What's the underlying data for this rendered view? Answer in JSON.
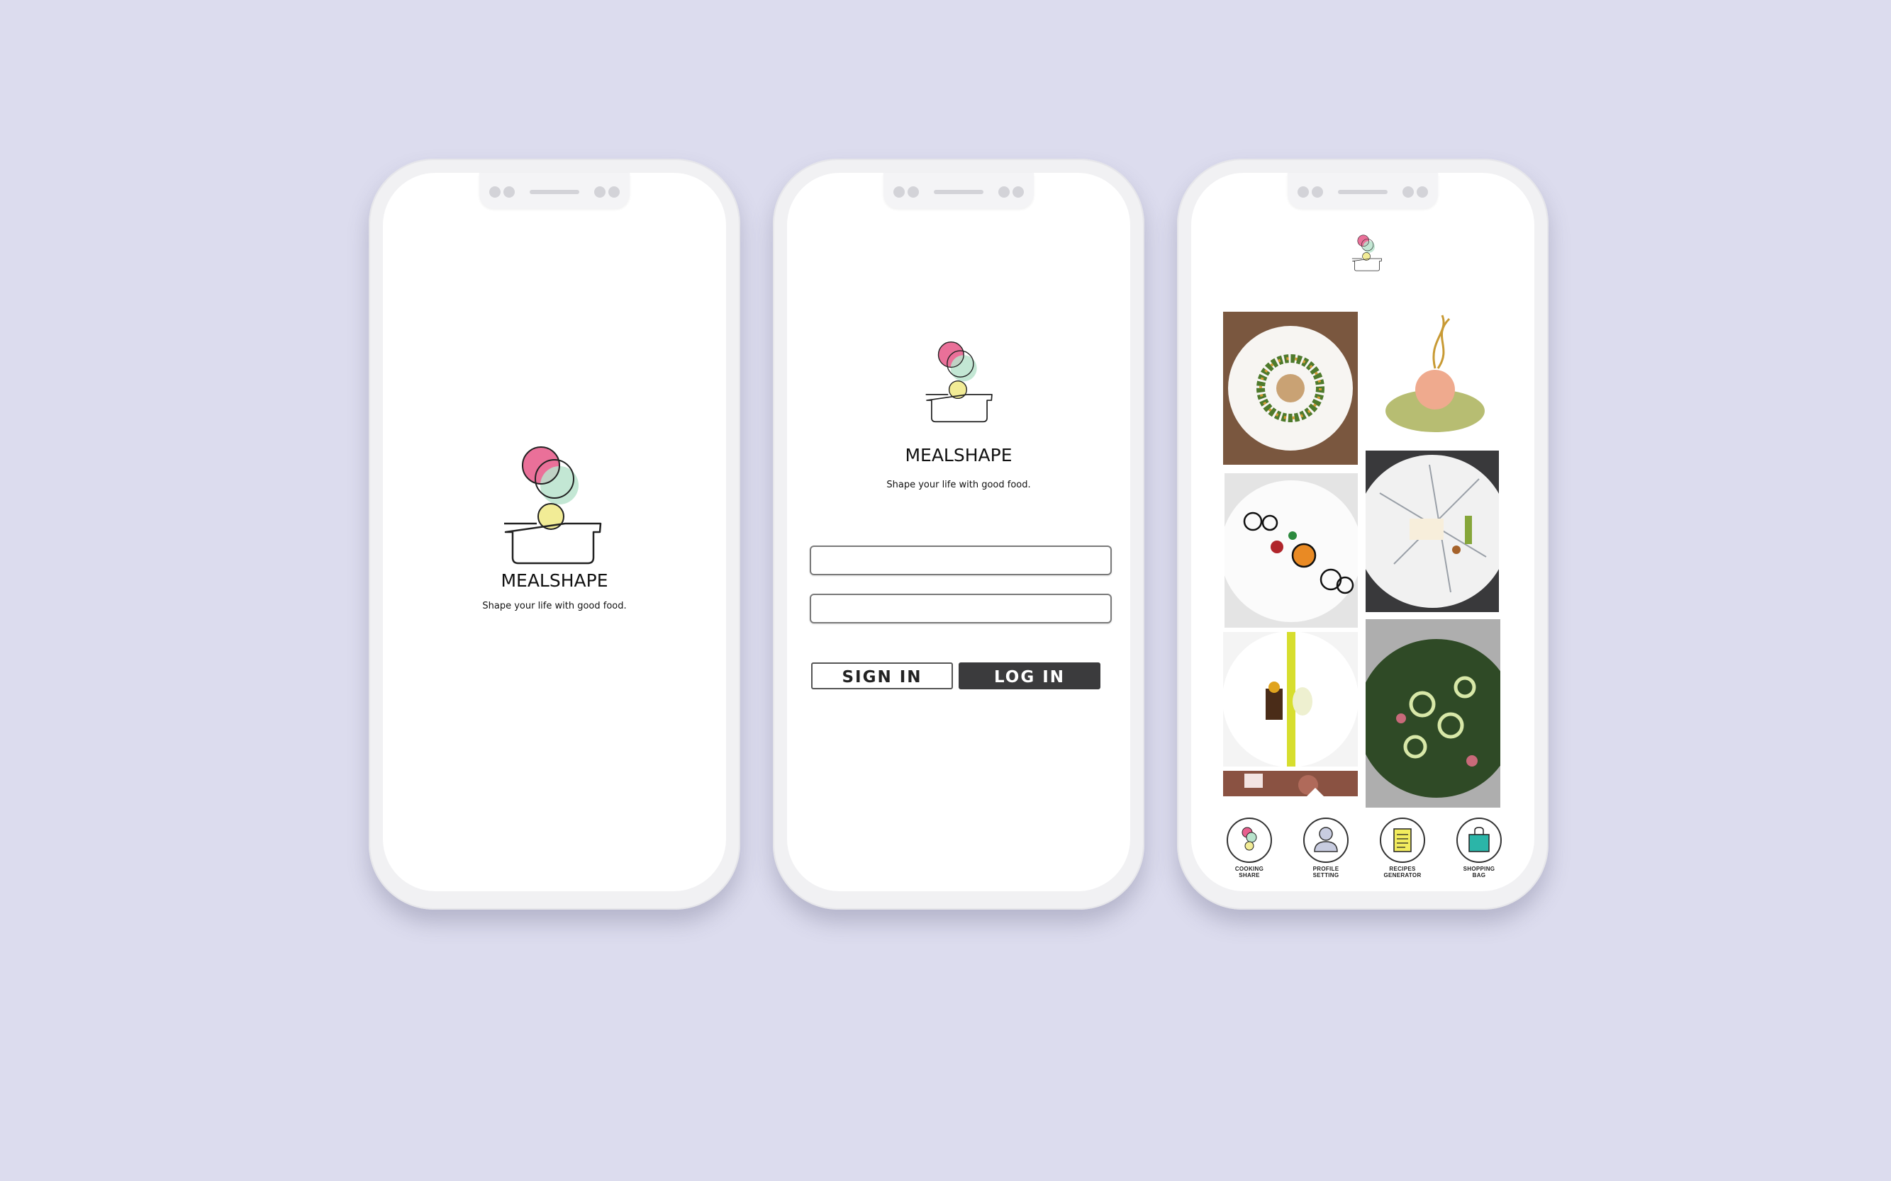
{
  "app": {
    "brand_name": "MEALSHAPE",
    "tagline": "Shape your life with good food."
  },
  "login": {
    "username_value": "",
    "password_value": "",
    "sign_in_label": "SIGN IN",
    "log_in_label": "LOG IN"
  },
  "feed": {
    "tiles": [
      {
        "name": "plate-ring-dish"
      },
      {
        "name": "citrus-broth-dish"
      },
      {
        "name": "black-rings-dish"
      },
      {
        "name": "white-plate-lines-dish"
      },
      {
        "name": "yellow-stripe-dish"
      },
      {
        "name": "green-salad-dish"
      },
      {
        "name": "dessert-partial-dish"
      }
    ]
  },
  "bottom_nav": [
    {
      "icon": "cooking-share-icon",
      "label_line1": "COOKING",
      "label_line2": "SHARE"
    },
    {
      "icon": "profile-icon",
      "label_line1": "PROFILE",
      "label_line2": "SETTING"
    },
    {
      "icon": "recipe-document-icon",
      "label_line1": "RECIPES",
      "label_line2": "GENERATOR"
    },
    {
      "icon": "shopping-bag-icon",
      "label_line1": "SHOPPING",
      "label_line2": "BAG"
    }
  ],
  "colors": {
    "background": "#dcdcee",
    "logo_pink": "#e8608e",
    "logo_mint": "#b8e3cc",
    "logo_yellow": "#f2ec96",
    "log_in_button": "#3b3b3d",
    "bag_teal": "#2bb5a8"
  }
}
